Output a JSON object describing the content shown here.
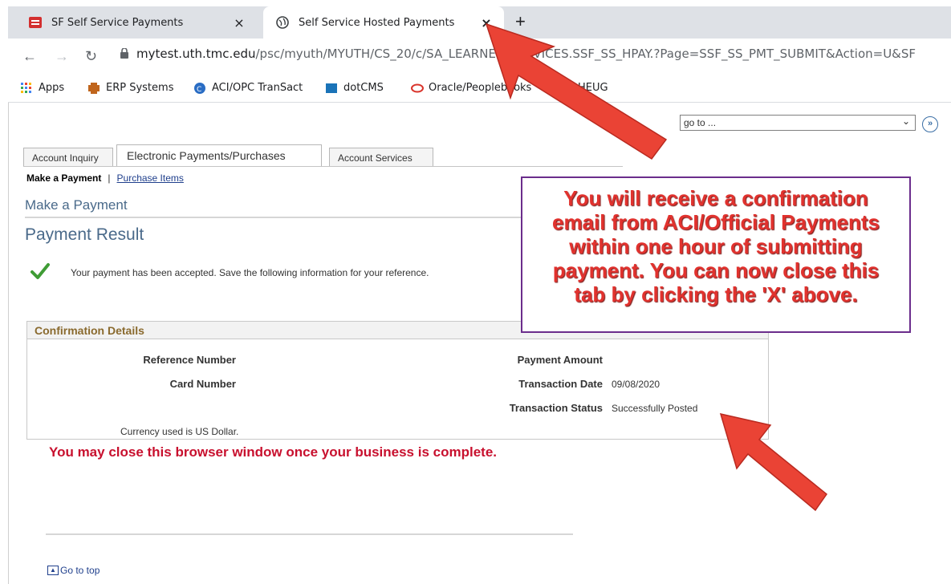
{
  "browser": {
    "tabs": [
      {
        "title": "SF Self Service Payments",
        "active": false
      },
      {
        "title": "Self Service Hosted Payments",
        "active": true
      }
    ],
    "close_glyph": "×",
    "new_tab_glyph": "+",
    "url_host": "mytest.uth.tmc.edu",
    "url_path": "/psc/myuth/MYUTH/CS_20/c/SA_LEARNER_SERVICES.SSF_SS_HPAY.?Page=SSF_SS_PMT_SUBMIT&Action=U&SF",
    "bookmarks": [
      "Apps",
      "ERP Systems",
      "ACI/OPC TranSact",
      "dotCMS",
      "Oracle/Peoplebooks",
      "HEUG"
    ]
  },
  "page": {
    "goto_placeholder": "go to ...",
    "tabs": [
      "Account Inquiry",
      "Electronic Payments/Purchases",
      "Account Services"
    ],
    "subnav": {
      "current": "Make a Payment",
      "separator": "|",
      "link": "Purchase Items"
    },
    "section_title": "Make a Payment",
    "result_title": "Payment Result",
    "accepted_message": "Your payment has been accepted. Save the following information for your reference.",
    "confirmation": {
      "header": "Confirmation Details",
      "reference_label": "Reference Number",
      "card_label": "Card Number",
      "amount_label": "Payment Amount",
      "date_label": "Transaction Date",
      "date_value": "09/08/2020",
      "status_label": "Transaction Status",
      "status_value": "Successfully Posted",
      "currency_note": "Currency used is US Dollar."
    },
    "close_message": "You may close this browser window once your business is complete.",
    "go_to_top": "Go to top"
  },
  "callout": {
    "lines": [
      "You will receive a confirmation",
      "email from ACI/Official Payments",
      "within one hour of submitting",
      "payment. You can now close this",
      "tab by clicking the 'X' above."
    ]
  },
  "colors": {
    "callout_text": "#e1322e",
    "callout_border": "#6b2d8c",
    "arrow": "#ea4335",
    "close_message": "#c8102e"
  }
}
